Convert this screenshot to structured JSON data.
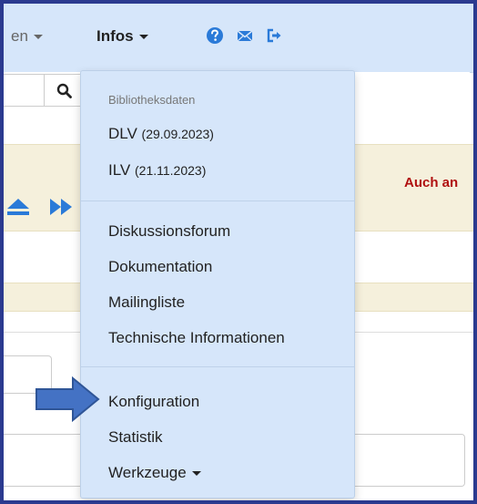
{
  "navbar": {
    "partial_menu_label": "en",
    "infos_label": "Infos"
  },
  "alert": {
    "text": "Auch an"
  },
  "dropdown": {
    "header": "Bibliotheksdaten",
    "items": [
      {
        "label": "DLV",
        "date": "(29.09.2023)"
      },
      {
        "label": "ILV",
        "date": "(21.11.2023)"
      },
      {
        "label": "Diskussionsforum"
      },
      {
        "label": "Dokumentation"
      },
      {
        "label": "Mailingliste"
      },
      {
        "label": "Technische Informationen"
      },
      {
        "label": "Konfiguration"
      },
      {
        "label": "Statistik"
      },
      {
        "label": "Werkzeuge"
      }
    ]
  },
  "colors": {
    "navbar_bg": "#d6e6fa",
    "accent_blue": "#2a7ad8",
    "alert_red": "#b01010",
    "notice_band": "#f5f0dc",
    "annotation_arrow": "#4472c4"
  },
  "icons": [
    "question-circle-icon",
    "envelope-icon",
    "sign-out-icon",
    "search-icon",
    "eject-icon",
    "fast-forward-icon",
    "caret-down-icon"
  ]
}
